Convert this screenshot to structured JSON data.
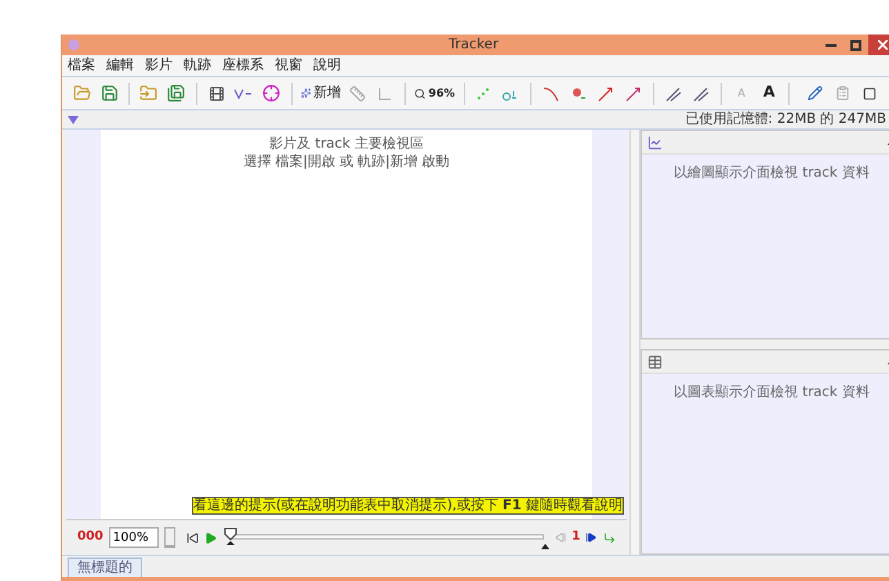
{
  "window": {
    "title": "Tracker"
  },
  "menu": [
    "檔案",
    "編輯",
    "影片",
    "軌跡",
    "座標系",
    "視窗",
    "說明"
  ],
  "toolbar": {
    "new_label": "新增",
    "zoom": "96%",
    "font_smaller": "A",
    "font_larger": "A"
  },
  "memory": "已使用記憶體: 22MB 的 247MB",
  "video_panel": {
    "lines": [
      "影片及 track 主要檢視區",
      "選擇 檔案|開啟 或 軌跡|新增 啟動"
    ],
    "hint": "看這邊的提示(或在說明功能表中取消提示),或按下 **F1** 鍵隨時觀看說明"
  },
  "player": {
    "frame": "000",
    "rate": "100%",
    "level": 0,
    "step": "1"
  },
  "plot_panel": {
    "message": "以繪圖顯示介面檢視 track 資料"
  },
  "table_panel": {
    "message": "以圖表顯示介面檢視 track 資料"
  },
  "tabs": [
    {
      "label": "無標題的",
      "selected": true
    }
  ]
}
